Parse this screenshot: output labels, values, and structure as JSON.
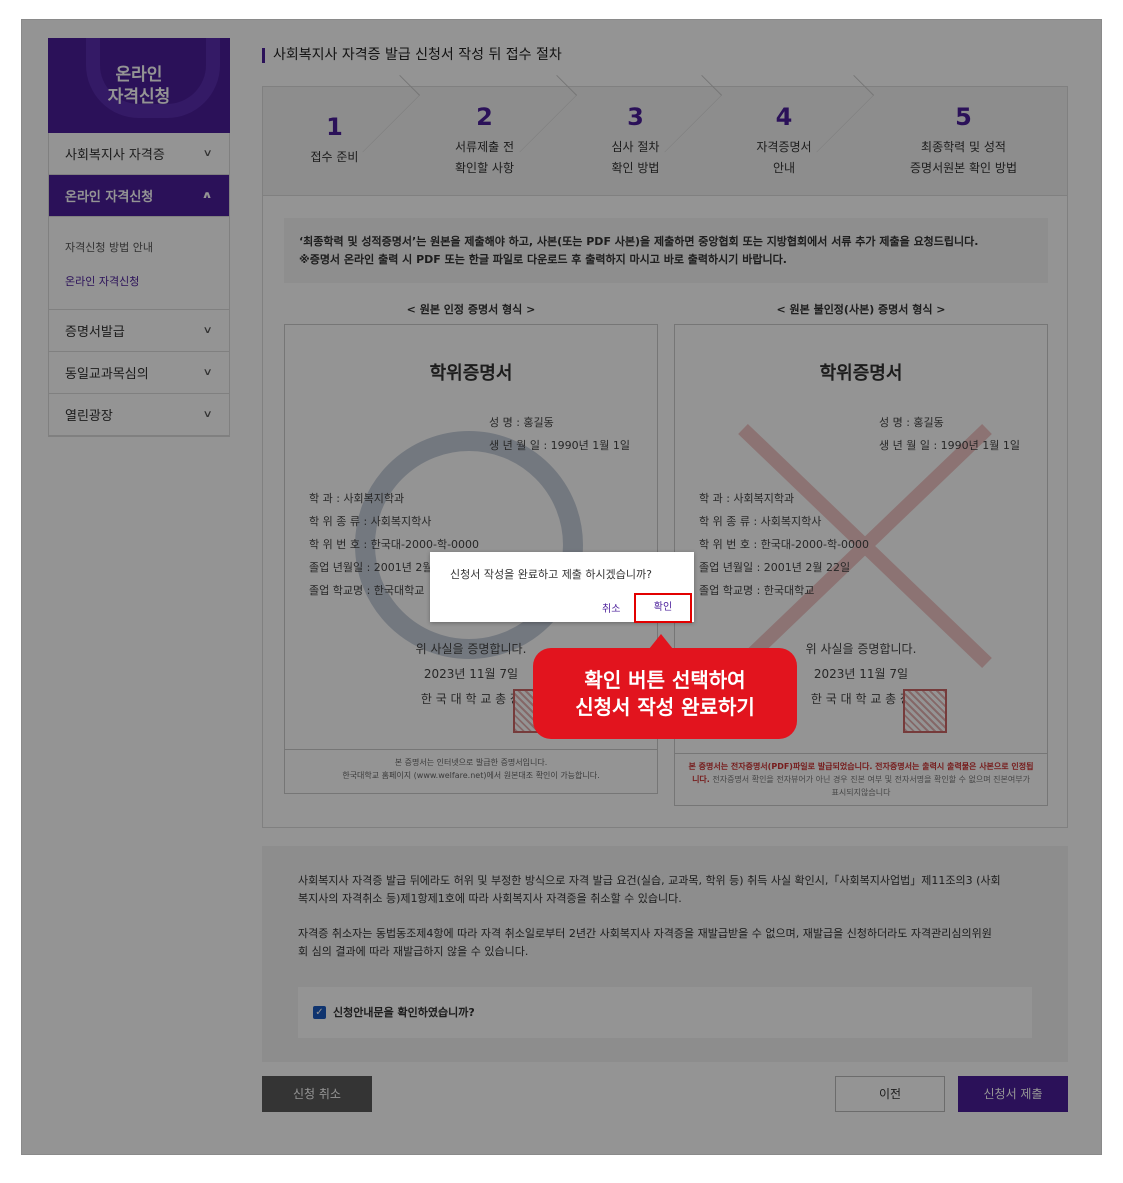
{
  "sidebar": {
    "logo_line1": "온라인",
    "logo_line2": "자격신청",
    "items": [
      {
        "label": "사회복지사 자격증"
      },
      {
        "label": "온라인 자격신청"
      },
      {
        "label": "증명서발급"
      },
      {
        "label": "동일교과목심의"
      },
      {
        "label": "열린광장"
      }
    ],
    "sub_items": [
      {
        "label": "자격신청 방법 안내"
      },
      {
        "label": "온라인 자격신청"
      }
    ]
  },
  "main": {
    "title": "사회복지사 자격증 발급 신청서 작성 뒤 접수 절차",
    "steps": [
      {
        "num": "1",
        "line1": "접수 준비",
        "line2": ""
      },
      {
        "num": "2",
        "line1": "서류제출 전",
        "line2": "확인할 사항"
      },
      {
        "num": "3",
        "line1": "심사 절차",
        "line2": "확인 방법"
      },
      {
        "num": "4",
        "line1": "자격증명서",
        "line2": "안내"
      },
      {
        "num": "5",
        "line1": "최종학력 및 성적",
        "line2": "증명서원본 확인 방법"
      }
    ],
    "notice_line1": "‘최종학력 및 성적증명서’는 원본을 제출해야 하고, 사본(또는 PDF 사본)을 제출하면 중앙협회 또는 지방협회에서 서류 추가 제출을 요청드립니다.",
    "notice_line2": "※증명서 온라인 출력 시 PDF 또는 한글 파일로 다운로드 후 출력하지 마시고 바로 출력하시기 바랍니다."
  },
  "certs": {
    "left_caption": "< 원본 인정 증명서 형식 >",
    "right_caption": "< 원본 불인정(사본) 증명서 형식 >",
    "title": "학위증명서",
    "name_row": "성        명 :  홍길동",
    "birth_row": "생 년 월 일  :  1990년 1월 1일",
    "dept_row": "학        과 :  사회복지학과",
    "degree_row": "학 위 종 류 :  사회복지학사",
    "degree_no_row": "학 위 번 호 :  한국대-2000-학-0000",
    "grad_date_row": "졸업 년월일  :  2001년 2월 22일",
    "school_row": "졸업 학교명  :  한국대학교",
    "proof": "위 사실을 증명합니다.",
    "date": "2023년 11월 7일",
    "president": "한 국 대 학 교 총 장",
    "left_footer_line1": "본 증명서는 인터넷으로 발급한 증명서입니다.",
    "left_footer_line2": "한국대학교 홈페이지 (www.welfare.net)에서 원본대조 확인이 가능합니다.",
    "right_footer_red1": "본 증명서는 전자증명서(PDF)파일로 발급되었습니다. 전자증명서는 출력시 출력물은 사본으로 인정됩",
    "right_footer_red2": "니다.",
    "right_footer_gray2": " 전자증명서 확인을 전자뷰어가 아닌 경우 진본 여부 및 전자서명을 확인할 수 없으며 진본여부가",
    "right_footer_gray3": "표시되지않습니다"
  },
  "info": {
    "para1_line1": "사회복지사 자격증 발급 뒤에라도 허위 및 부정한 방식으로 자격 발급 요건(실습, 교과목, 학위 등) 취득 사실 확인시,「사회복지사업법」제11조의3 (사회",
    "para1_line2": "복지사의 자격취소 등)제1항제1호에 따라 사회복지사 자격증을 취소할 수 있습니다.",
    "para2_line1": "자격증 취소자는 동법동조제4항에 따라 자격 취소일로부터 2년간 사회복지사 자격증을 재발급받을 수 없으며, 재발급을 신청하더라도 자격관리심의위원",
    "para2_line2": "회 심의 결과에 따라 재발급하지 않을 수 있습니다.",
    "checkbox_label": "신청안내문을 확인하였습니까?"
  },
  "buttons": {
    "cancel": "신청 취소",
    "prev": "이전",
    "submit": "신청서 제출"
  },
  "dialog": {
    "message": "신청서 작성을 완료하고 제출 하시겠습니까?",
    "cancel": "취소",
    "ok": "확인"
  },
  "callout": {
    "line1": "확인 버튼 선택하여",
    "line2": "신청서 작성 완료하기"
  },
  "colors": {
    "brand_purple": "#4a1e9a",
    "callout_red": "#e2141e",
    "highlight_border": "#e20000"
  }
}
